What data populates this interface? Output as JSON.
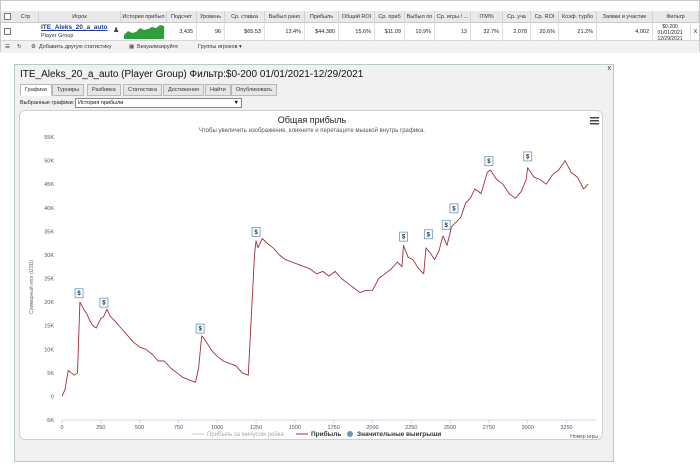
{
  "stats_table": {
    "headers": [
      "Стр",
      "Игрок",
      "История прибыл",
      "Подсчет",
      "Уровень",
      "Ср. ставка",
      "Выбыл рано",
      "Прибыль",
      "Общий ROI",
      "Ср. приб",
      "Выбыл по",
      "Ср. игры / ...",
      "ITM%",
      "Ср. уча",
      "Ср. ROI",
      "Коэф. турбо",
      "Заявки и участие",
      "Фильтр"
    ],
    "row": {
      "player_name": "ITE_Aleks_20_a_auto",
      "player_group": "Player Group",
      "count": "3,435",
      "level": "96",
      "avg_stake": "$65.53",
      "early_out": "13.4%",
      "profit": "$44,380",
      "total_roi": "15.6%",
      "avg_profit": "$11.09",
      "out_by": "10.9%",
      "avg_games": "13",
      "itm": "32.7%",
      "avg_part": "2,078",
      "avg_roi": "20.6%",
      "turbo": "21.2%",
      "entries": "4,002",
      "filter": "$0-200 01/01/2021 12/29/2021",
      "remove": "X"
    },
    "footer": {
      "add_stat": "Добавить другую статистику",
      "visualize": "Визуализируйте",
      "groups": "Группы игроков ▾"
    }
  },
  "report": {
    "title": "ITE_Aleks_20_a_auto (Player Group) Фильтр:$0-200 01/01/2021-12/29/2021",
    "close": "x",
    "tabs": [
      "Графики",
      "Турниры",
      "Разбивка",
      "Статистика",
      "Достижения",
      "Найти",
      "Опубликовать"
    ],
    "active_tab": 0,
    "select_label": "Выбранные графики:",
    "select_value": "История прибыли"
  },
  "chart_data": {
    "type": "line",
    "title": "Общая прибыль",
    "subtitle": "Чтобы увеличить изображение, кликните и перетащите мышкой внутрь графика.",
    "xlabel": "Номер игры",
    "ylabel": "Суммарный итог (USD)",
    "xlim": [
      0,
      3440
    ],
    "ylim": [
      -5000,
      55000
    ],
    "x_ticks": [
      0,
      250,
      500,
      750,
      1000,
      1250,
      1500,
      1750,
      2000,
      2250,
      2500,
      2750,
      3000,
      3250
    ],
    "y_ticks": [
      -5000,
      0,
      5000,
      10000,
      15000,
      20000,
      25000,
      30000,
      35000,
      40000,
      45000,
      50000,
      55000
    ],
    "y_tick_labels": [
      "-5K",
      "0",
      "5K",
      "10K",
      "15K",
      "20K",
      "25K",
      "30K",
      "35K",
      "40K",
      "45K",
      "50K",
      "55K"
    ],
    "series": [
      {
        "name": "Прибыль",
        "color": "#a0303c",
        "x": [
          0,
          20,
          40,
          60,
          80,
          100,
          115,
          140,
          160,
          180,
          200,
          220,
          250,
          270,
          290,
          310,
          340,
          380,
          420,
          460,
          500,
          540,
          580,
          620,
          660,
          700,
          740,
          780,
          820,
          860,
          880,
          900,
          910,
          940,
          970,
          1000,
          1040,
          1080,
          1120,
          1160,
          1200,
          1240,
          1250,
          1262,
          1290,
          1320,
          1360,
          1400,
          1440,
          1480,
          1520,
          1560,
          1600,
          1640,
          1680,
          1720,
          1760,
          1800,
          1840,
          1880,
          1920,
          1960,
          2000,
          2040,
          2080,
          2120,
          2160,
          2190,
          2200,
          2230,
          2260,
          2300,
          2330,
          2345,
          2370,
          2400,
          2430,
          2445,
          2455,
          2480,
          2510,
          2540,
          2570,
          2600,
          2630,
          2660,
          2700,
          2740,
          2760,
          2800,
          2840,
          2880,
          2920,
          2960,
          2990,
          3000,
          3040,
          3080,
          3120,
          3160,
          3200,
          3240,
          3280,
          3320,
          3360,
          3390
        ],
        "y": [
          0,
          1500,
          5500,
          5000,
          4500,
          5000,
          20000,
          18500,
          17500,
          16000,
          15000,
          14500,
          16500,
          17000,
          18500,
          17000,
          16000,
          14500,
          13000,
          11500,
          10500,
          10000,
          9000,
          7500,
          7500,
          6000,
          5000,
          4000,
          3500,
          3000,
          6000,
          12800,
          12500,
          11000,
          9500,
          8500,
          7500,
          7000,
          6500,
          5000,
          4500,
          30000,
          33000,
          31500,
          33500,
          32500,
          31500,
          30000,
          29000,
          28500,
          28000,
          27500,
          27000,
          26000,
          26500,
          25500,
          26500,
          25000,
          24000,
          23000,
          22000,
          22500,
          22500,
          25000,
          26000,
          27000,
          28500,
          27500,
          32000,
          29500,
          29000,
          27000,
          26000,
          31500,
          30500,
          29000,
          31000,
          33000,
          34000,
          32000,
          36000,
          37000,
          38000,
          41000,
          42000,
          44000,
          43000,
          47500,
          48000,
          46000,
          45000,
          43000,
          42000,
          43500,
          46000,
          48500,
          46500,
          46000,
          45000,
          47000,
          48000,
          50000,
          47500,
          46500,
          44000,
          45000
        ]
      },
      {
        "name": "Прибыль за минусом рейка",
        "color": "#c8c8c8",
        "x": [],
        "y": []
      },
      {
        "name": "Значительные выигрыши",
        "color": "#6d95b9",
        "marker": "$",
        "x": [
          110,
          270,
          890,
          1250,
          2200,
          2360,
          2475,
          2525,
          2750,
          3000
        ],
        "y": [
          20500,
          18500,
          13000,
          33500,
          32500,
          33000,
          35000,
          38500,
          48500,
          49500
        ]
      }
    ],
    "legend_position": "bottom",
    "grid": false,
    "menu_icon": "hamburger-icon"
  }
}
